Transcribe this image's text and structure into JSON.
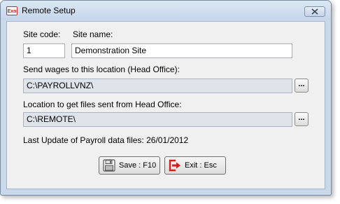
{
  "window": {
    "title": "Remote Setup",
    "icon_text": "Exo",
    "close_icon": "close-icon"
  },
  "form": {
    "site_code_label": "Site code:",
    "site_name_label": "Site name:",
    "site_code_value": "1",
    "site_name_value": "Demonstration Site",
    "send_wages_label": "Send wages to this location (Head Office):",
    "send_wages_value": "C:\\PAYROLLVNZ\\",
    "location_files_label": "Location to get files sent from Head Office:",
    "location_files_value": "C:\\REMOTE\\",
    "browse_label": "...",
    "last_update_text": "Last Update of Payroll data files: 26/01/2012"
  },
  "buttons": {
    "save_label": "Save : F10",
    "exit_label": "Exit : Esc",
    "save_icon": "floppy-disk-icon",
    "exit_icon": "exit-door-icon"
  }
}
